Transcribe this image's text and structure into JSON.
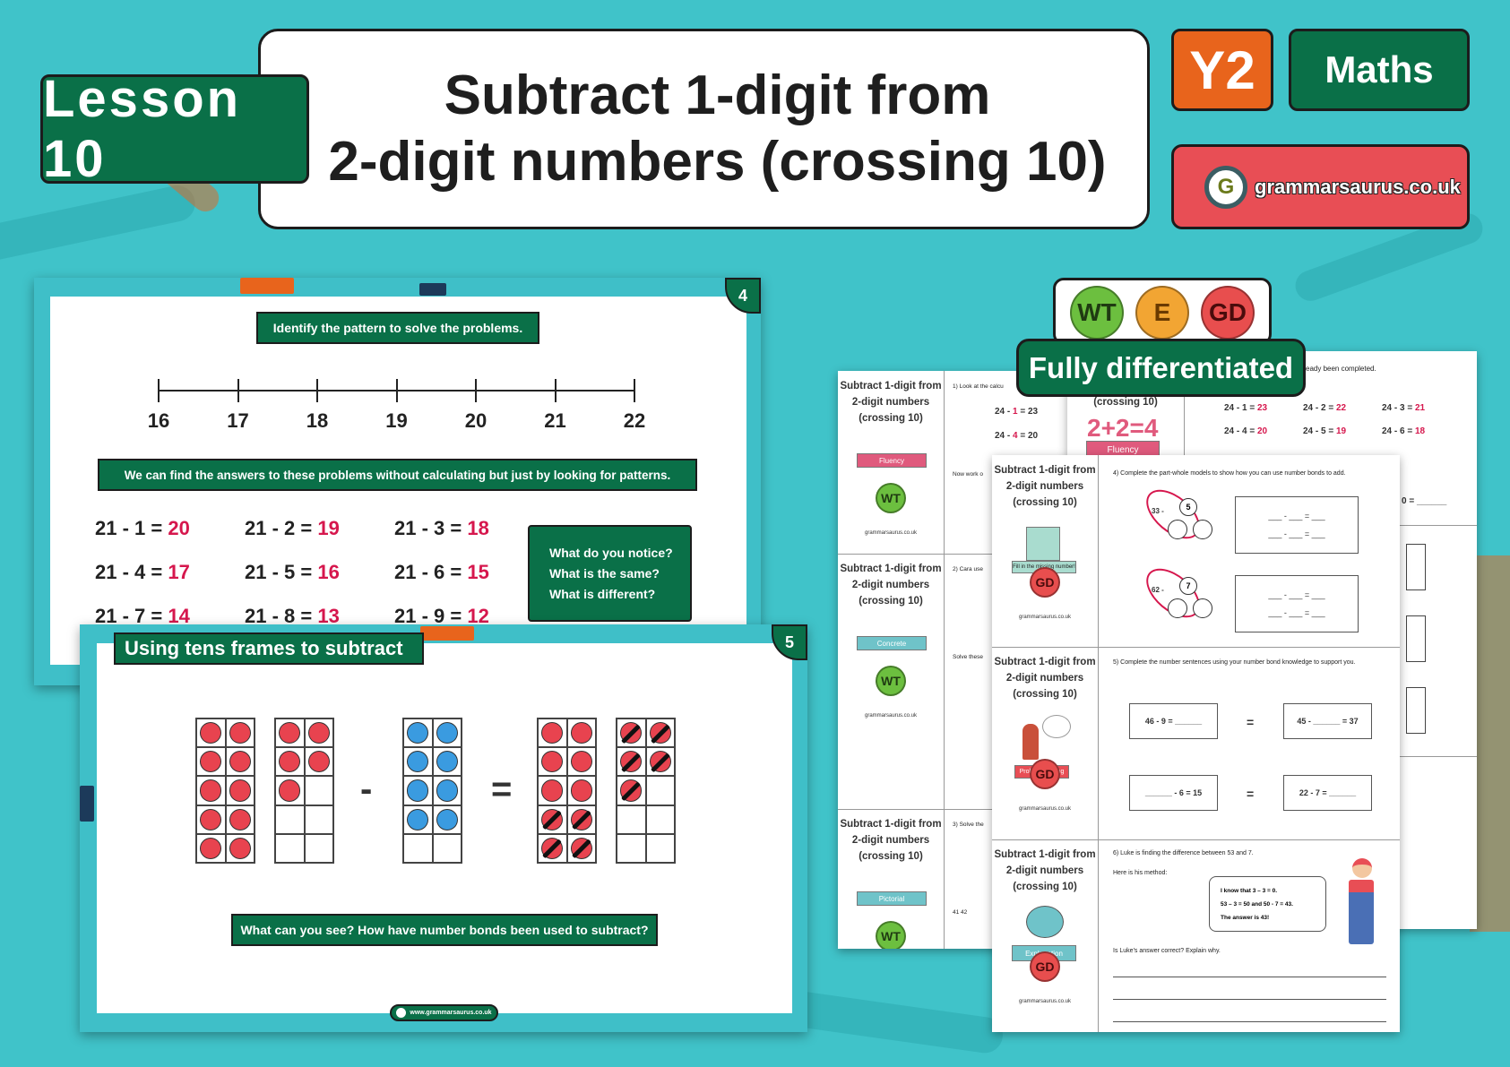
{
  "header": {
    "lesson": "Lesson 10",
    "title_line1": "Subtract 1-digit from",
    "title_line2": "2-digit numbers (crossing 10)",
    "year": "Y2",
    "subject": "Maths",
    "brand": "grammarsaurus.co.uk",
    "brand_logo_letter": "G"
  },
  "colors": {
    "background": "#40c3c9",
    "dark_green": "#0a7048",
    "orange": "#e8641c",
    "brand_red": "#e84e55",
    "answer_pink": "#d6174d",
    "counter_red": "#e8434f",
    "counter_blue": "#3a9be0"
  },
  "slide4": {
    "number": "4",
    "instruction": "Identify the pattern to solve the problems.",
    "number_line": [
      "16",
      "17",
      "18",
      "19",
      "20",
      "21",
      "22"
    ],
    "hint": "We can find the answers to these problems without calculating but just by looking for patterns.",
    "equations": [
      {
        "q": "21 - 1 = ",
        "a": "20"
      },
      {
        "q": "21 - 2 = ",
        "a": "19"
      },
      {
        "q": "21 - 3 = ",
        "a": "18"
      },
      {
        "q": "21 - 4 = ",
        "a": "17"
      },
      {
        "q": "21 - 5 = ",
        "a": "16"
      },
      {
        "q": "21 - 6 = ",
        "a": "15"
      },
      {
        "q": "21 - 7 = ",
        "a": "14"
      },
      {
        "q": "21 - 8 = ",
        "a": "13"
      },
      {
        "q": "21 - 9 = ",
        "a": "12"
      }
    ],
    "questions": [
      "What do you notice?",
      "What is the same?",
      "What is different?"
    ]
  },
  "slide5": {
    "number": "5",
    "title": "Using tens frames to subtract",
    "minus": "-",
    "equals": "=",
    "frames": [
      {
        "color": "red",
        "filled": 10,
        "crossed": 0
      },
      {
        "color": "red",
        "filled": 5,
        "crossed": 0
      },
      {
        "color": "blue",
        "filled": 8,
        "crossed": 0
      },
      {
        "color": "red",
        "filled": 10,
        "crossed": 4,
        "cross_from_end": true
      },
      {
        "color": "red",
        "filled": 5,
        "crossed": 5
      }
    ],
    "question": "What can you see? How have number bonds been used to subtract?",
    "footer_url": "www.grammarsaurus.co.uk"
  },
  "differentiation": {
    "badges": [
      "WT",
      "E",
      "GD"
    ],
    "label": "Fully differentiated"
  },
  "worksheets": {
    "card_title": [
      "Subtract 1-digit from",
      "2-digit numbers",
      "(crossing 10)"
    ],
    "footer": "grammarsaurus.co.uk",
    "back_left": {
      "cards": [
        {
          "category": "Fluency",
          "level": "WT",
          "question": "1) Look at the calcu",
          "lines": [
            {
              "q": "24 - ",
              "r": "1",
              "s": " = 23"
            },
            {
              "q": "24 - ",
              "r": "4",
              "s": " = 20"
            }
          ],
          "extra": "Now work o"
        },
        {
          "category": "Concrete",
          "level": "WT",
          "question": "2) Cara use",
          "extra": "Solve these"
        },
        {
          "category": "Pictorial",
          "level": "WT",
          "question": "3) Solve the",
          "extra": "41  42"
        }
      ]
    },
    "back_right": {
      "header_fragment": "eady been completed.",
      "title_fragment": "(crossing 10)",
      "category": "Fluency",
      "equations": [
        {
          "q": "24 - 1 = ",
          "a": "23"
        },
        {
          "q": "24 - 2 = ",
          "a": "22"
        },
        {
          "q": "24 - 3 = ",
          "a": "21"
        },
        {
          "q": "24 - 4 = ",
          "a": "20"
        },
        {
          "q": "24 - 5 = ",
          "a": "19"
        },
        {
          "q": "24 - 6 = ",
          "a": "18"
        }
      ],
      "fragment": "0 = ______"
    },
    "front": {
      "q4": {
        "category": "Fill in the missing number!",
        "level": "GD",
        "text": "4) Complete the part-whole models to show how you can use number bonds to add.",
        "models": [
          {
            "whole": "33 -",
            "part": "5"
          },
          {
            "whole": "62 -",
            "part": "7"
          }
        ],
        "blank": "___ - ___ = ___"
      },
      "q5": {
        "category": "Problem solving",
        "level": "GD",
        "text": "5) Complete the number sentences using your number bond knowledge to support you.",
        "boxes": [
          "46 - 9 = ______",
          "45 - ______ = 37",
          "______ - 6 = 15",
          "22 - 7 = ______"
        ],
        "equals": "="
      },
      "q6": {
        "category": "Explanation",
        "level": "GD",
        "text": "6) Luke is finding the difference between 53 and 7.",
        "method": "Here is his method:",
        "bubble": [
          "I know that 3 – 3 = 0.",
          "53 – 3 = 50 and 50 - 7 = 43.",
          "The answer is 43!"
        ],
        "prompt": "Is Luke's answer correct? Explain why."
      }
    }
  }
}
